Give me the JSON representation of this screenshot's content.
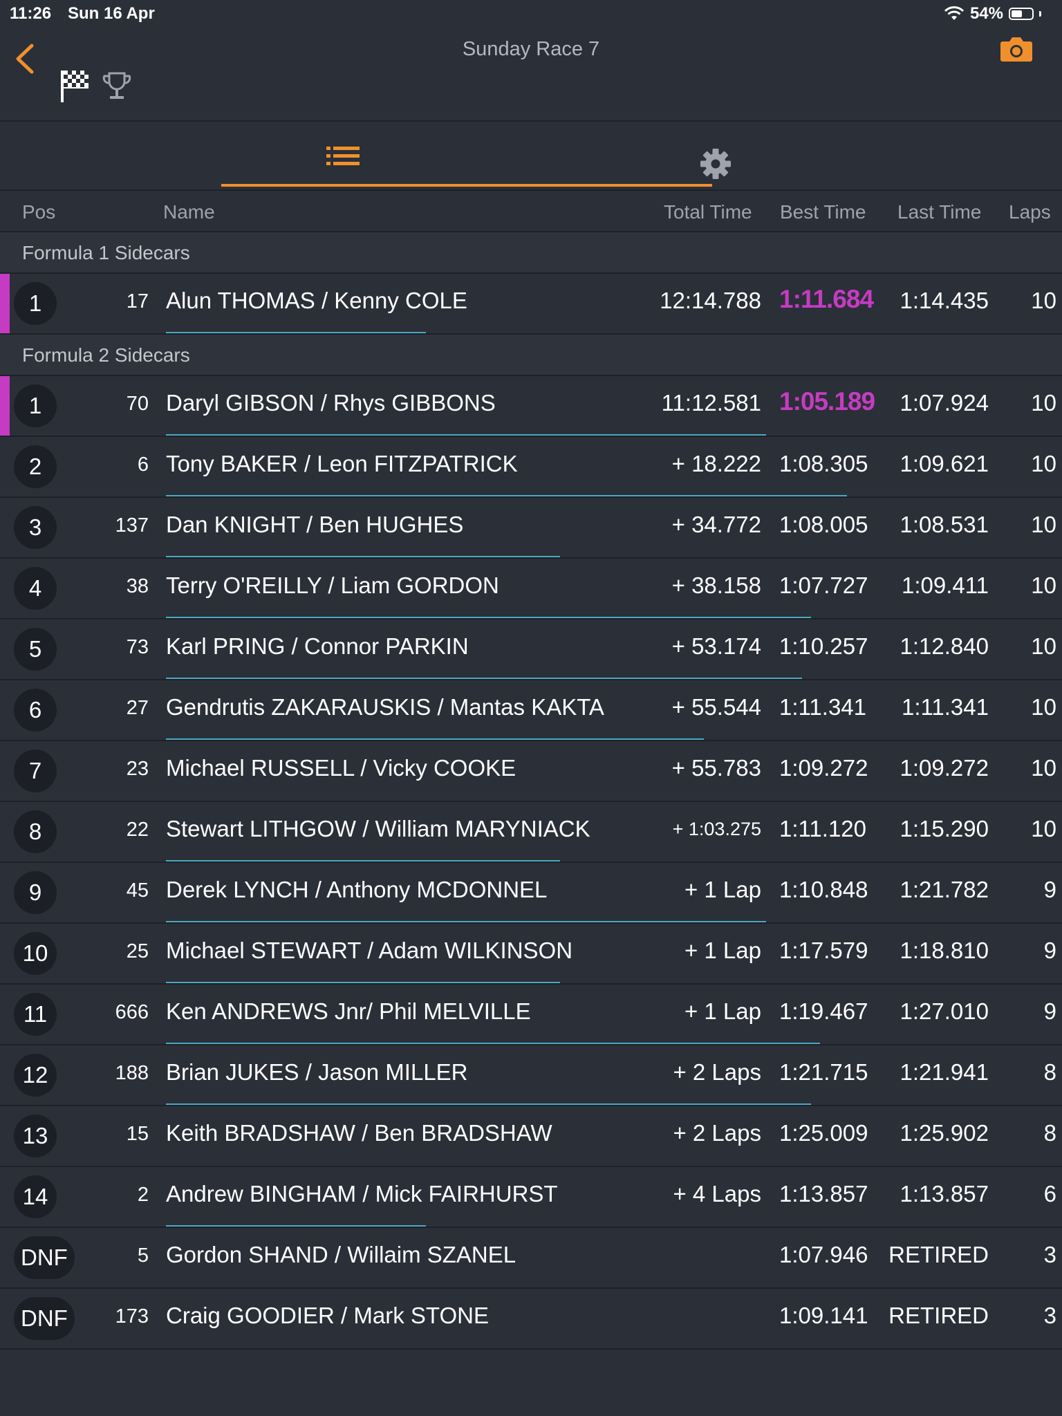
{
  "status": {
    "time": "11:26",
    "date": "Sun 16 Apr",
    "battery": "54%",
    "battery_level": 0.54
  },
  "header": {
    "title": "Sunday Race 7"
  },
  "columns": {
    "pos": "Pos",
    "name": "Name",
    "total": "Total Time",
    "best": "Best Time",
    "last": "Last Time",
    "laps": "Laps"
  },
  "colors": {
    "accent": "#f0902d",
    "fastest": "#c53cc2",
    "progress": "#4aa9c7",
    "background": "#2b2f38"
  },
  "groups": [
    {
      "title": "Formula 1 Sidecars"
    },
    {
      "title": "Formula 2 Sidecars"
    }
  ],
  "rows": [
    {
      "pos": "1",
      "num": "17",
      "name": "Alun THOMAS / Kenny COLE",
      "total": "12:14.788",
      "best": "1:11.684",
      "last": "1:14.435",
      "laps": "10",
      "progress": 0.29
    },
    {
      "pos": "1",
      "num": "70",
      "name": "Daryl GIBSON / Rhys GIBBONS",
      "total": "11:12.581",
      "best": "1:05.189",
      "last": "1:07.924",
      "laps": "10",
      "progress": 0.67
    },
    {
      "pos": "2",
      "num": "6",
      "name": "Tony BAKER / Leon FITZPATRICK",
      "total": "+ 18.222",
      "best": "1:08.305",
      "last": "1:09.621",
      "laps": "10",
      "progress": 0.76
    },
    {
      "pos": "3",
      "num": "137",
      "name": "Dan KNIGHT / Ben HUGHES",
      "total": "+ 34.772",
      "best": "1:08.005",
      "last": "1:08.531",
      "laps": "10",
      "progress": 0.44
    },
    {
      "pos": "4",
      "num": "38",
      "name": "Terry O'REILLY /  Liam GORDON",
      "total": "+ 38.158",
      "best": "1:07.727",
      "last": "1:09.411",
      "laps": "10",
      "progress": 0.72
    },
    {
      "pos": "5",
      "num": "73",
      "name": "Karl PRING / Connor PARKIN",
      "total": "+ 53.174",
      "best": "1:10.257",
      "last": "1:12.840",
      "laps": "10",
      "progress": 0.71
    },
    {
      "pos": "6",
      "num": "27",
      "name": "Gendrutis ZAKARAUSKIS / Mantas KAKTA",
      "total": "+ 55.544",
      "best": "1:11.341",
      "last": "1:11.341",
      "laps": "10",
      "progress": 0.6
    },
    {
      "pos": "7",
      "num": "23",
      "name": "Michael RUSSELL /  Vicky COOKE",
      "total": "+ 55.783",
      "best": "1:09.272",
      "last": "1:09.272",
      "laps": "10",
      "progress": 0.0
    },
    {
      "pos": "8",
      "num": "22",
      "name": "Stewart LITHGOW / William MARYNIACK",
      "total": "+ 1:03.275",
      "best": "1:11.120",
      "last": "1:15.290",
      "laps": "10",
      "progress": 0.44
    },
    {
      "pos": "9",
      "num": "45",
      "name": "Derek LYNCH / Anthony MCDONNEL",
      "total": "+ 1 Lap",
      "best": "1:10.848",
      "last": "1:21.782",
      "laps": "9",
      "progress": 0.67
    },
    {
      "pos": "10",
      "num": "25",
      "name": "Michael STEWART / Adam WILKINSON",
      "total": "+ 1 Lap",
      "best": "1:17.579",
      "last": "1:18.810",
      "laps": "9",
      "progress": 0.44
    },
    {
      "pos": "11",
      "num": "666",
      "name": "Ken ANDREWS Jnr/ Phil MELVILLE",
      "total": "+ 1 Lap",
      "best": "1:19.467",
      "last": "1:27.010",
      "laps": "9",
      "progress": 0.73
    },
    {
      "pos": "12",
      "num": "188",
      "name": "Brian JUKES / Jason MILLER",
      "total": "+ 2 Laps",
      "best": "1:21.715",
      "last": "1:21.941",
      "laps": "8",
      "progress": 0.72
    },
    {
      "pos": "13",
      "num": "15",
      "name": "Keith BRADSHAW / Ben BRADSHAW",
      "total": "+ 2 Laps",
      "best": "1:25.009",
      "last": "1:25.902",
      "laps": "8",
      "progress": 0.0
    },
    {
      "pos": "14",
      "num": "2",
      "name": "Andrew BINGHAM /  Mick FAIRHURST",
      "total": "+ 4 Laps",
      "best": "1:13.857",
      "last": "1:13.857",
      "laps": "6",
      "progress": 0.29
    },
    {
      "pos": "DNF",
      "num": "5",
      "name": "Gordon SHAND /  Willaim SZANEL",
      "total": "",
      "best": "1:07.946",
      "last": "RETIRED",
      "laps": "3",
      "progress": 0.0
    },
    {
      "pos": "DNF",
      "num": "173",
      "name": "Craig GOODIER / Mark STONE",
      "total": "",
      "best": "1:09.141",
      "last": "RETIRED",
      "laps": "3",
      "progress": 0.0
    }
  ]
}
